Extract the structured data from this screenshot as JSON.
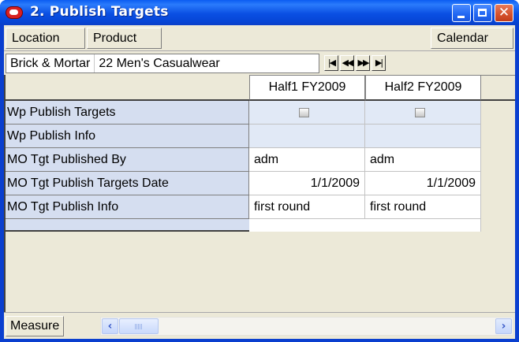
{
  "window": {
    "title": "2. Publish Targets",
    "controls": [
      "minimize-icon",
      "maximize-icon",
      "close-icon"
    ],
    "colors": {
      "titlebar": "#0a4fe3",
      "close_button": "#d4502c",
      "row_header_bg": "#d5def0",
      "readonly_cell_bg": "#e1e9f6"
    }
  },
  "dimension_tiles": {
    "location": "Location",
    "product": "Product",
    "calendar": "Calendar"
  },
  "slice": {
    "location_value": "Brick & Mortar",
    "product_value": "22 Men's Casualwear",
    "nav_buttons": [
      "first-icon",
      "previous-icon",
      "next-icon",
      "last-icon"
    ]
  },
  "grid": {
    "columns": [
      "Half1 FY2009",
      "Half2 FY2009"
    ],
    "rows": [
      {
        "label": "Wp Publish Targets",
        "cells": [
          {
            "type": "checkbox",
            "checked": false
          },
          {
            "type": "checkbox",
            "checked": false
          }
        ]
      },
      {
        "label": "Wp Publish Info",
        "cells": [
          "",
          ""
        ]
      },
      {
        "label": "MO Tgt Published By",
        "cells": [
          "adm",
          "adm"
        ]
      },
      {
        "label": "MO Tgt Publish Targets Date",
        "cells": [
          "1/1/2009",
          "1/1/2009"
        ]
      },
      {
        "label": "MO Tgt Publish Info",
        "cells": [
          "first round",
          "first round"
        ]
      }
    ]
  },
  "bottom": {
    "measure": "Measure",
    "scroll_left": "‹",
    "scroll_right": "›"
  }
}
